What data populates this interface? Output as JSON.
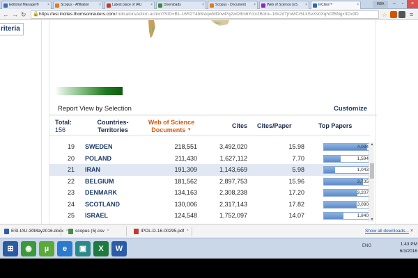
{
  "browser": {
    "tabs": [
      {
        "label": "Editorial Manager®",
        "color": "#3a6db5"
      },
      {
        "label": "Scopus - Affiliation",
        "color": "#e07a1f"
      },
      {
        "label": "Latest place of IAU",
        "color": "#c0392b"
      },
      {
        "label": "Downloads",
        "color": "#3a8a3a"
      },
      {
        "label": "Scopus - Document",
        "color": "#e07a1f"
      },
      {
        "label": "Web of Science [v.5.",
        "color": "#8a2ab0"
      },
      {
        "label": "InCites™",
        "color": "#2a6ab0"
      }
    ],
    "profile_label": "MBA",
    "address": {
      "host": "https://esi.incites.thomsonreuters.com",
      "path": "/IndicatorsAction.action?SID=B1-L6R2T4b8stqwMDnwPq2wD8m6Yctx2BoIru-18x2dTjmMCr5LkSvXs0XqhOfBNgx3Dx3D"
    }
  },
  "page": {
    "left_tab_label": "riteria",
    "report_title": "Report View by Selection",
    "customize_label": "Customize",
    "headers": {
      "total_label": "Total:",
      "total_value": "156",
      "countries": "Countries-Territories",
      "docs": "Web of Science Documents",
      "cites": "Cites",
      "cites_paper": "Cites/Paper",
      "top_papers": "Top Papers"
    },
    "rows": [
      {
        "rank": "19",
        "country": "SWEDEN",
        "docs": "218,551",
        "cites": "3,492,020",
        "cpp": "15.98",
        "top": "4,084",
        "top_value": 4084
      },
      {
        "rank": "20",
        "country": "POLAND",
        "docs": "211,430",
        "cites": "1,627,112",
        "cpp": "7.70",
        "top": "1,594",
        "top_value": 1594
      },
      {
        "rank": "21",
        "country": "IRAN",
        "docs": "191,309",
        "cites": "1,143,669",
        "cpp": "5.98",
        "top": "1,043",
        "top_value": 1043
      },
      {
        "rank": "22",
        "country": "BELGIUM",
        "docs": "181,562",
        "cites": "2,897,753",
        "cpp": "15.96",
        "top": "3,735",
        "top_value": 3735
      },
      {
        "rank": "23",
        "country": "DENMARK",
        "docs": "134,163",
        "cites": "2,308,238",
        "cpp": "17.20",
        "top": "3,207",
        "top_value": 3207
      },
      {
        "rank": "24",
        "country": "SCOTLAND",
        "docs": "130,006",
        "cites": "2,317,143",
        "cpp": "17.82",
        "top": "3,090",
        "top_value": 3090
      },
      {
        "rank": "25",
        "country": "ISRAEL",
        "docs": "124,548",
        "cites": "1,752,097",
        "cpp": "14.07",
        "top": "1,840",
        "top_value": 1840
      }
    ],
    "highlighted_row": 2,
    "top_papers_scale_max": 4300
  },
  "downloads": {
    "items": [
      {
        "label": "ESI-IAU-30May2016.docx",
        "color": "#2a5caa"
      },
      {
        "label": "scopus (5).csv",
        "color": "#4a8a4a"
      },
      {
        "label": "IPOL-D-16-00295.pdf",
        "color": "#c0392b"
      }
    ],
    "show_all": "Show all downloads..."
  },
  "taskbar": {
    "apps": [
      {
        "name": "start",
        "glyph": "⊞",
        "color": "#2c5aa0"
      },
      {
        "name": "chrome",
        "glyph": "◉",
        "color": "#3a9a3a"
      },
      {
        "name": "utorrent",
        "glyph": "µ",
        "color": "#5aaa3a"
      },
      {
        "name": "ie",
        "glyph": "e",
        "color": "#2a7ad0"
      },
      {
        "name": "store",
        "glyph": "▣",
        "color": "#2a8a8a"
      },
      {
        "name": "excel",
        "glyph": "X",
        "color": "#1e7a3e"
      },
      {
        "name": "word",
        "glyph": "W",
        "color": "#2a5caa"
      }
    ],
    "tray_lang": "ENG",
    "time": "1:43 PM",
    "date": "6/3/2016"
  }
}
